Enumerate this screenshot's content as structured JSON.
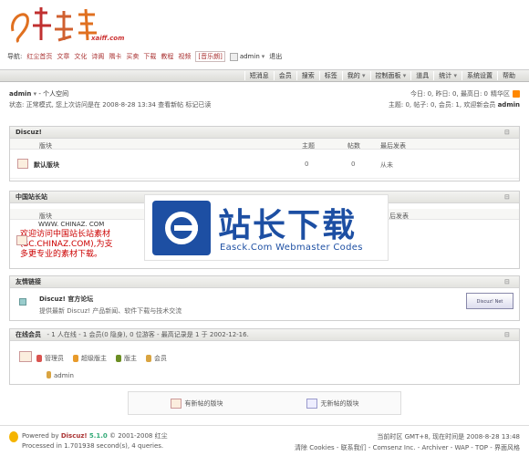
{
  "colors": {
    "accent": "#a33333",
    "watermark_blue": "#1d4fa3",
    "logo_orange": "#e07020"
  },
  "logo": {
    "domain": "xaiff.com",
    "icon": "site-logo-icon"
  },
  "topnav": {
    "label": "导航:",
    "links": [
      "红尘首页",
      "文章",
      "文化",
      "诗阁",
      "隅卡",
      "买卖",
      "下载",
      "教程",
      "视频"
    ],
    "music": "[音乐朗]",
    "user": "admin",
    "logout": "退出"
  },
  "menubar": [
    "短消息",
    "会员",
    "搜索",
    "标签",
    "我的",
    "控制面板",
    "道具",
    "统计",
    "系统设置",
    "帮助"
  ],
  "userbar": {
    "username": "admin",
    "space": "- 个人空间",
    "status": "状态: 正常模式, 您上次访问是在 2008-8-28 13:34   查看新帖   标记已读",
    "today": "今日: 0, 昨日: 0, 最高日: 0",
    "digest": "精华区",
    "stats_prefix": "主题: 0, 帖子: 0, 会员: 1, 欢迎新会员",
    "newest_member": "admin"
  },
  "discuz_box": {
    "title": "Discuz!",
    "cols": [
      "版块",
      "主题",
      "帖数",
      "最后发表"
    ],
    "forum": {
      "name": "默认版块",
      "topics": "0",
      "posts": "0",
      "last": "从未"
    }
  },
  "china_box": {
    "title": "中国站长站",
    "col": "版块",
    "col_right": "后发表",
    "promo_brand": "WWW. CHINAZ. COM",
    "promo_line1": "欢迎访问中国站长站素材",
    "promo_line2": "(SC.CHINAZ.COM),为支",
    "promo_line3": "多更专业的素材下载。"
  },
  "watermark": {
    "title": "站长下载",
    "subtitle": "Easck.Com Webmaster Codes"
  },
  "links_box": {
    "title": "友情链接",
    "name": "Discuz! 官方论坛",
    "desc": "提供最新 Discuz! 产品新闻、软件下载与技术交流",
    "badge": "Discuz! Net"
  },
  "online_box": {
    "title": "在线会员",
    "summary": "- 1 人在线 - 1 会员(0 隐身), 0 位游客 - 最高记录是 1 于 2002-12-16.",
    "legend": [
      "管理员",
      "超级版主",
      "版主",
      "会员"
    ],
    "legend_colors": [
      "#d9534f",
      "#e89b2b",
      "#6b8e23",
      "#d9a441"
    ],
    "online_user": "admin"
  },
  "status_icons": {
    "new": "有新帖的版块",
    "none": "无新帖的版块"
  },
  "footer": {
    "powered": "Powered by",
    "brand": "Discuz!",
    "version": "5.1.0",
    "copyright": "© 2001-2008 红尘",
    "processed": "Processed in 1.701938 second(s), 4 queries.",
    "timezone": "当前时区 GMT+8, 现在时间是 2008-8-28 13:48",
    "links": "清除 Cookies - 联系我们 - Comsenz Inc. - Archiver - WAP - TOP - 界面风格"
  }
}
